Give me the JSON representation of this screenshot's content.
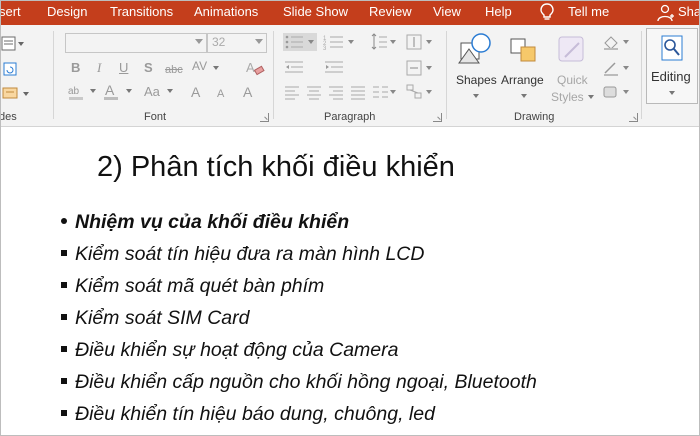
{
  "tabs": [
    "sert",
    "Design",
    "Transitions",
    "Animations",
    "Slide Show",
    "Review",
    "View",
    "Help",
    "Tell me",
    "Sha"
  ],
  "ribbon": {
    "slides_label_partial": "des",
    "font_group_label": "Font",
    "font_size_value": "32",
    "paragraph_group_label": "Paragraph",
    "drawing_group_label": "Drawing",
    "shapes_label": "Shapes",
    "arrange_label": "Arrange",
    "quick_styles_label_1": "Quick",
    "quick_styles_label_2": "Styles",
    "editing_label": "Editing",
    "fmt_b": "B",
    "fmt_i": "I",
    "fmt_u": "U",
    "fmt_s": "S",
    "fmt_abc": "abc",
    "fmt_av": "AV",
    "fmt_aa": "Aa",
    "fmt_a_big": "A",
    "fmt_a_small": "A",
    "fmt_a_color": "A"
  },
  "slide": {
    "title": "2) Phân tích khối điều khiển",
    "bullets": [
      "Nhiệm vụ của khối điều khiển",
      "Kiểm soát tín hiệu đưa ra màn hình LCD",
      "Kiểm soát mã quét bàn phím",
      "Kiểm soát SIM Card",
      "Điều khiển sự hoạt động của Camera",
      "Điều khiển cấp nguồn cho khối hồng ngoại, Bluetooth",
      "Điều khiển tín hiệu báo dung, chuông, led"
    ]
  },
  "colors": {
    "tab_bar": "#c43e1c",
    "ribbon_bg": "#f3f3f3",
    "accent_blue": "#2b579a"
  }
}
